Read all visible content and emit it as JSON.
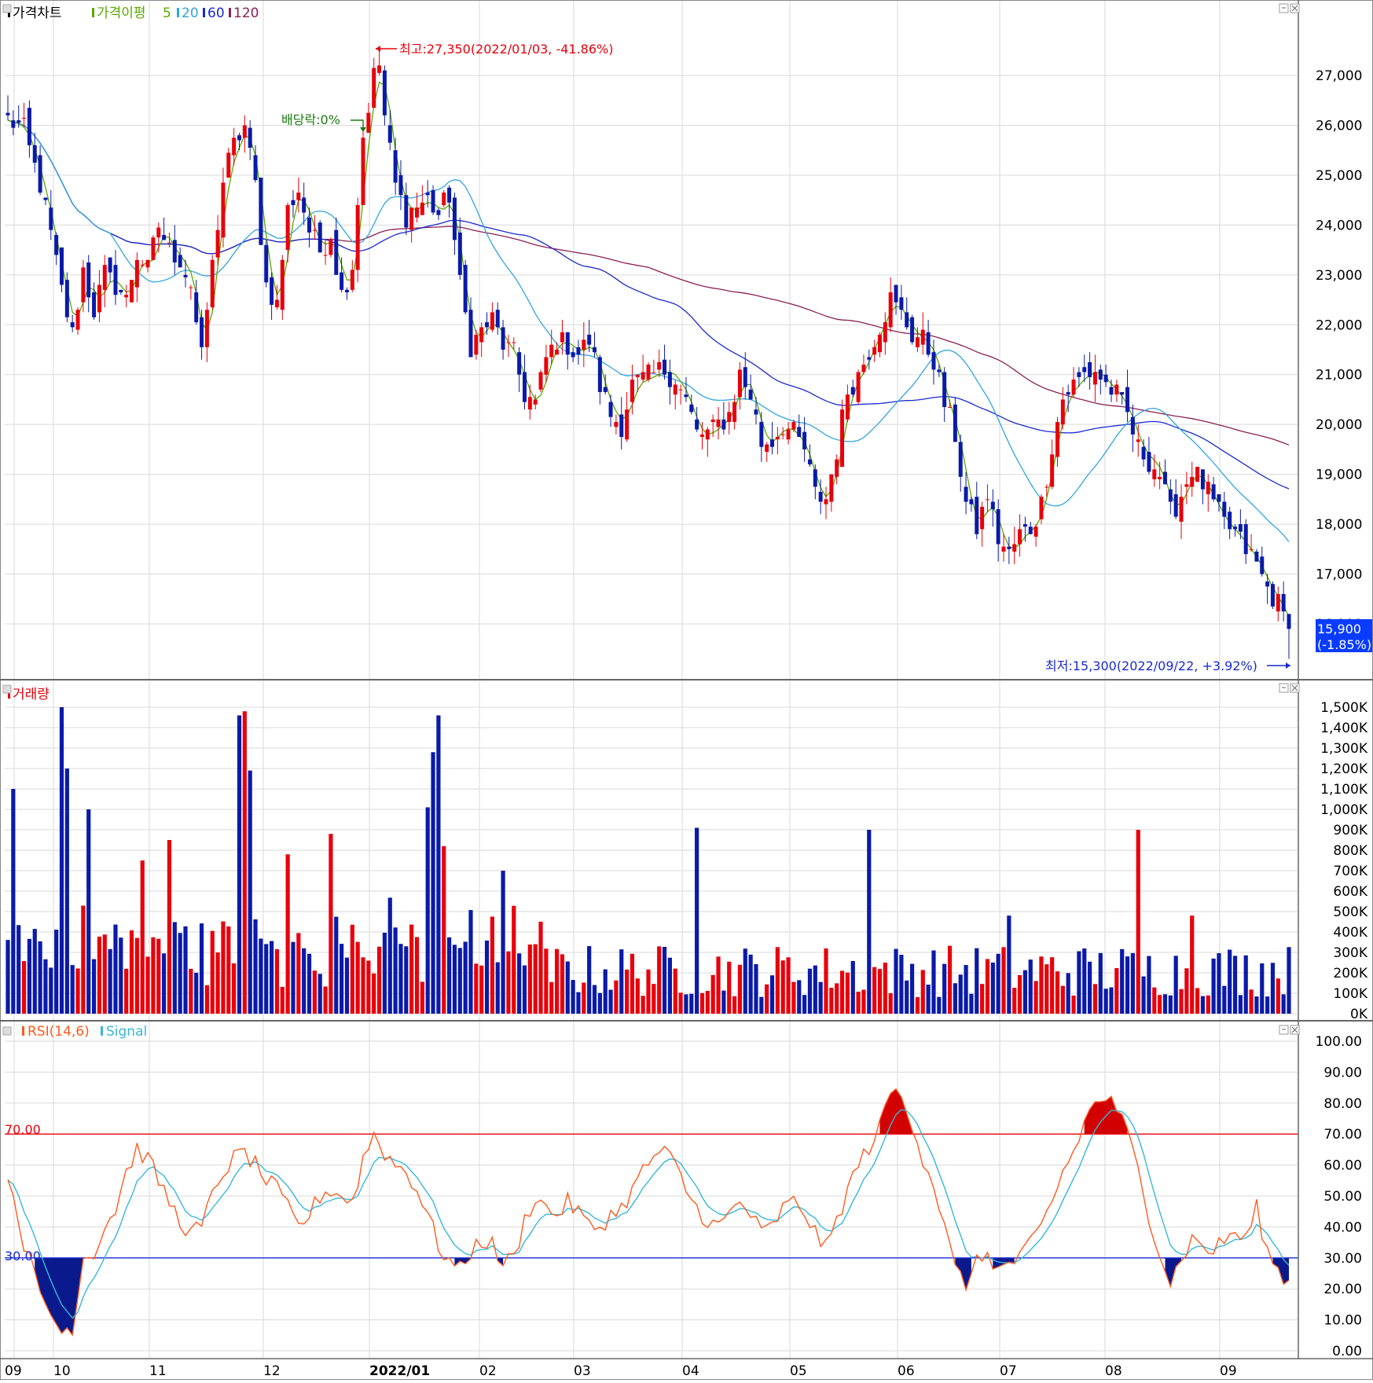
{
  "colors": {
    "up": "#e8000b",
    "down": "#0a1aa8",
    "ma5": "#5aa800",
    "ma20": "#2fa6e0",
    "ma60": "#1a2ad0",
    "ma120": "#8a2050",
    "rsi": "#ff5a1e",
    "signal": "#37b8d8",
    "overbought_fill": "#d20000",
    "oversold_fill": "#0a1a8c",
    "grid": "#dadada",
    "price_tag_bg": "#0a3cff"
  },
  "price_panel": {
    "legend": {
      "title": "가격차트",
      "ma_label": "가격이평",
      "ma_periods": [
        "5",
        "20",
        "60",
        "120"
      ]
    },
    "y_ticks": [
      "27,000",
      "26,000",
      "25,000",
      "24,000",
      "23,000",
      "22,000",
      "21,000",
      "20,000",
      "19,000",
      "18,000",
      "17,000",
      "16,000"
    ],
    "current_price": "15,900",
    "current_change": "(-1.85%)",
    "high_label": "최고:27,350(2022/01/03, -41.86%)",
    "low_label": "최저:15,300(2022/09/22, +3.92%)",
    "dividend_label": "배당락:0%"
  },
  "volume_panel": {
    "legend": "거래량",
    "y_ticks": [
      "1,500K",
      "1,400K",
      "1,300K",
      "1,200K",
      "1,100K",
      "1,000K",
      "900K",
      "800K",
      "700K",
      "600K",
      "500K",
      "400K",
      "300K",
      "200K",
      "100K",
      "0K"
    ]
  },
  "rsi_panel": {
    "legend_rsi": "RSI(14,6)",
    "legend_signal": "Signal",
    "y_ticks": [
      "100.00",
      "90.00",
      "80.00",
      "70.00",
      "60.00",
      "50.00",
      "40.00",
      "30.00",
      "20.00",
      "10.00",
      "0.00"
    ],
    "line_70_label": "70.00",
    "line_30_label": "30.00"
  },
  "x_axis": [
    "09",
    "10",
    "11",
    "12",
    "2022/01",
    "02",
    "03",
    "04",
    "05",
    "06",
    "07",
    "08",
    "09"
  ],
  "chart_data": {
    "type": "candlestick",
    "period": "2021/09 - 2022/09 (daily)",
    "price": {
      "ylim": [
        15300,
        27350
      ],
      "high": {
        "value": 27350,
        "date": "2022/01/03",
        "change_pct": -41.86
      },
      "low": {
        "value": 15300,
        "date": "2022/09/22",
        "change_pct": 3.92
      },
      "last": {
        "value": 15900,
        "change_pct": -1.85
      },
      "anchors": [
        [
          0,
          26100
        ],
        [
          3,
          25900
        ],
        [
          6,
          24800
        ],
        [
          8,
          23800
        ],
        [
          10,
          22700
        ],
        [
          12,
          21800
        ],
        [
          14,
          23100
        ],
        [
          16,
          22300
        ],
        [
          18,
          23000
        ],
        [
          20,
          22800
        ],
        [
          22,
          22500
        ],
        [
          24,
          23400
        ],
        [
          26,
          23100
        ],
        [
          28,
          24000
        ],
        [
          30,
          23500
        ],
        [
          32,
          23300
        ],
        [
          34,
          22800
        ],
        [
          36,
          21300
        ],
        [
          37,
          22300
        ],
        [
          40,
          24900
        ],
        [
          42,
          25600
        ],
        [
          44,
          26000
        ],
        [
          46,
          24800
        ],
        [
          48,
          22800
        ],
        [
          50,
          22400
        ],
        [
          52,
          24300
        ],
        [
          54,
          24700
        ],
        [
          56,
          23900
        ],
        [
          58,
          23500
        ],
        [
          60,
          23800
        ],
        [
          62,
          22600
        ],
        [
          64,
          23200
        ],
        [
          66,
          25800
        ],
        [
          68,
          27000
        ],
        [
          69,
          27200
        ],
        [
          70,
          26200
        ],
        [
          72,
          24800
        ],
        [
          74,
          24200
        ],
        [
          76,
          24400
        ],
        [
          78,
          24500
        ],
        [
          80,
          24200
        ],
        [
          82,
          24600
        ],
        [
          84,
          22800
        ],
        [
          86,
          21600
        ],
        [
          88,
          21900
        ],
        [
          90,
          22100
        ],
        [
          92,
          21600
        ],
        [
          94,
          21400
        ],
        [
          96,
          20600
        ],
        [
          98,
          20400
        ],
        [
          100,
          21300
        ],
        [
          102,
          21700
        ],
        [
          104,
          21600
        ],
        [
          106,
          21400
        ],
        [
          108,
          21700
        ],
        [
          110,
          20800
        ],
        [
          112,
          20200
        ],
        [
          114,
          20000
        ],
        [
          116,
          20800
        ],
        [
          118,
          20900
        ],
        [
          120,
          21000
        ],
        [
          122,
          21100
        ],
        [
          124,
          20900
        ],
        [
          126,
          20500
        ],
        [
          128,
          19800
        ],
        [
          130,
          19800
        ],
        [
          132,
          20000
        ],
        [
          134,
          20200
        ],
        [
          136,
          21000
        ],
        [
          138,
          20600
        ],
        [
          140,
          19600
        ],
        [
          142,
          19700
        ],
        [
          144,
          20000
        ],
        [
          146,
          19800
        ],
        [
          148,
          19500
        ],
        [
          150,
          18600
        ],
        [
          152,
          18500
        ],
        [
          154,
          19500
        ],
        [
          156,
          20700
        ],
        [
          158,
          21000
        ],
        [
          160,
          21500
        ],
        [
          162,
          22000
        ],
        [
          164,
          22500
        ],
        [
          166,
          22200
        ],
        [
          168,
          21800
        ],
        [
          170,
          21700
        ],
        [
          172,
          21300
        ],
        [
          174,
          20400
        ],
        [
          176,
          19800
        ],
        [
          178,
          18400
        ],
        [
          180,
          17900
        ],
        [
          182,
          18600
        ],
        [
          184,
          17700
        ],
        [
          186,
          17400
        ],
        [
          188,
          17800
        ],
        [
          190,
          17900
        ],
        [
          192,
          18400
        ],
        [
          194,
          19600
        ],
        [
          196,
          20500
        ],
        [
          198,
          20800
        ],
        [
          200,
          21000
        ],
        [
          202,
          21100
        ],
        [
          204,
          20800
        ],
        [
          206,
          20600
        ],
        [
          208,
          20200
        ],
        [
          210,
          19500
        ],
        [
          212,
          19300
        ],
        [
          214,
          19000
        ],
        [
          216,
          18200
        ],
        [
          218,
          18600
        ],
        [
          220,
          19100
        ],
        [
          222,
          18800
        ],
        [
          224,
          18400
        ],
        [
          226,
          18000
        ],
        [
          228,
          17800
        ],
        [
          230,
          17500
        ],
        [
          232,
          17200
        ],
        [
          234,
          16700
        ],
        [
          236,
          16400
        ],
        [
          238,
          15900
        ]
      ]
    },
    "volume": {
      "ylim": [
        0,
        1500000
      ],
      "unit": "K"
    },
    "rsi": {
      "ylim": [
        0,
        100
      ],
      "overbought": 70,
      "oversold": 30,
      "anchors": [
        [
          0,
          58
        ],
        [
          3,
          35
        ],
        [
          6,
          18
        ],
        [
          8,
          12
        ],
        [
          10,
          6
        ],
        [
          12,
          8
        ],
        [
          14,
          30
        ],
        [
          16,
          32
        ],
        [
          18,
          40
        ],
        [
          20,
          46
        ],
        [
          22,
          58
        ],
        [
          24,
          65
        ],
        [
          26,
          62
        ],
        [
          28,
          55
        ],
        [
          30,
          48
        ],
        [
          32,
          42
        ],
        [
          34,
          38
        ],
        [
          36,
          40
        ],
        [
          38,
          50
        ],
        [
          40,
          58
        ],
        [
          42,
          62
        ],
        [
          44,
          64
        ],
        [
          46,
          60
        ],
        [
          48,
          55
        ],
        [
          50,
          52
        ],
        [
          52,
          46
        ],
        [
          54,
          40
        ],
        [
          56,
          44
        ],
        [
          58,
          50
        ],
        [
          60,
          52
        ],
        [
          62,
          50
        ],
        [
          64,
          48
        ],
        [
          66,
          62
        ],
        [
          68,
          70
        ],
        [
          70,
          64
        ],
        [
          72,
          60
        ],
        [
          74,
          58
        ],
        [
          76,
          52
        ],
        [
          78,
          44
        ],
        [
          80,
          34
        ],
        [
          82,
          29
        ],
        [
          84,
          26
        ],
        [
          86,
          32
        ],
        [
          88,
          36
        ],
        [
          90,
          34
        ],
        [
          92,
          28
        ],
        [
          94,
          30
        ],
        [
          96,
          42
        ],
        [
          98,
          50
        ],
        [
          100,
          46
        ],
        [
          102,
          44
        ],
        [
          104,
          48
        ],
        [
          106,
          45
        ],
        [
          108,
          40
        ],
        [
          110,
          40
        ],
        [
          112,
          44
        ],
        [
          114,
          46
        ],
        [
          116,
          52
        ],
        [
          118,
          58
        ],
        [
          120,
          63
        ],
        [
          122,
          64
        ],
        [
          124,
          60
        ],
        [
          126,
          52
        ],
        [
          128,
          46
        ],
        [
          130,
          42
        ],
        [
          132,
          40
        ],
        [
          134,
          44
        ],
        [
          136,
          48
        ],
        [
          138,
          44
        ],
        [
          140,
          38
        ],
        [
          142,
          40
        ],
        [
          144,
          46
        ],
        [
          146,
          48
        ],
        [
          148,
          45
        ],
        [
          150,
          38
        ],
        [
          152,
          33
        ],
        [
          154,
          42
        ],
        [
          156,
          52
        ],
        [
          158,
          60
        ],
        [
          160,
          66
        ],
        [
          162,
          72
        ],
        [
          164,
          84
        ],
        [
          166,
          82
        ],
        [
          168,
          74
        ],
        [
          170,
          62
        ],
        [
          172,
          54
        ],
        [
          174,
          40
        ],
        [
          176,
          26
        ],
        [
          178,
          22
        ],
        [
          180,
          28
        ],
        [
          182,
          32
        ],
        [
          184,
          26
        ],
        [
          186,
          28
        ],
        [
          188,
          30
        ],
        [
          190,
          34
        ],
        [
          192,
          40
        ],
        [
          194,
          48
        ],
        [
          196,
          58
        ],
        [
          198,
          64
        ],
        [
          200,
          74
        ],
        [
          202,
          80
        ],
        [
          204,
          82
        ],
        [
          206,
          78
        ],
        [
          208,
          70
        ],
        [
          210,
          58
        ],
        [
          212,
          44
        ],
        [
          214,
          32
        ],
        [
          216,
          22
        ],
        [
          218,
          30
        ],
        [
          220,
          36
        ],
        [
          222,
          34
        ],
        [
          224,
          32
        ],
        [
          226,
          36
        ],
        [
          228,
          38
        ],
        [
          230,
          36
        ],
        [
          232,
          46
        ],
        [
          234,
          32
        ],
        [
          236,
          26
        ],
        [
          238,
          22
        ]
      ]
    },
    "signal_period": 6,
    "ma_periods": [
      5,
      20,
      60,
      120
    ]
  }
}
